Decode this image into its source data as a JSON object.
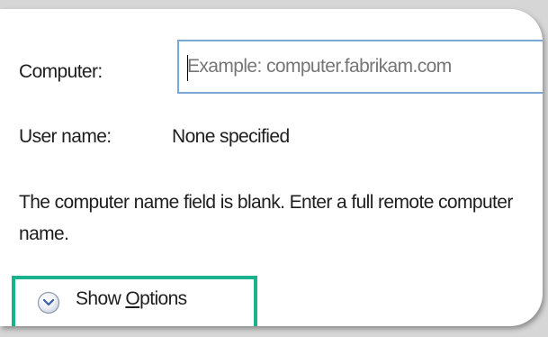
{
  "form": {
    "computer_label": "Computer:",
    "computer_placeholder": "Example: computer.fabrikam.com",
    "computer_value": "",
    "user_label": "User name:",
    "user_value": "None specified",
    "message": "The computer name field is blank. Enter a full remote computer name."
  },
  "options": {
    "label_prefix": "Show ",
    "label_accel": "O",
    "label_suffix": "ptions",
    "icon": "chevron-down-icon"
  },
  "colors": {
    "highlight": "#18b28e",
    "field_border": "#7aa7d6",
    "text": "#1e1e1e",
    "placeholder": "#767676"
  }
}
